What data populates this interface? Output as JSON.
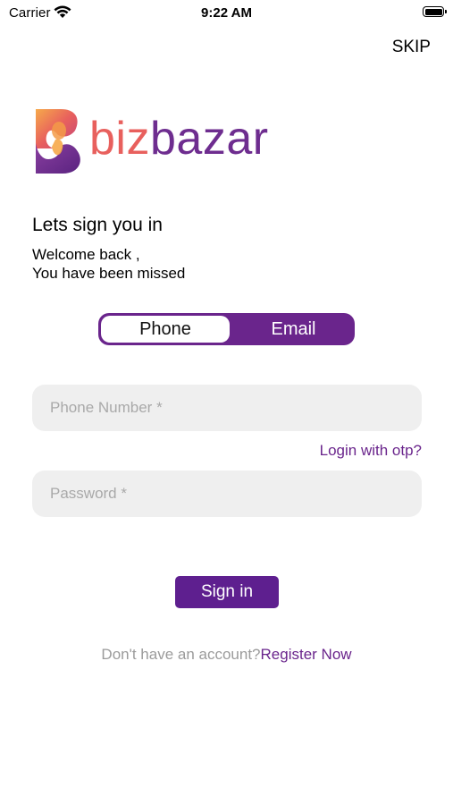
{
  "status_bar": {
    "carrier": "Carrier",
    "time": "9:22 AM",
    "icons": [
      "wifi-icon",
      "battery-icon"
    ]
  },
  "header": {
    "skip_label": "SKIP"
  },
  "logo": {
    "text_part1": "biz",
    "text_part2": "bazar",
    "colors": {
      "biz": "#e8605d",
      "bazar": "#6e2d8f",
      "mark_gradient": [
        "#f6a94a",
        "#e8605d",
        "#6e2d8f"
      ]
    }
  },
  "intro": {
    "heading": "Lets sign you in",
    "line1": "Welcome back ,",
    "line2": "You have been missed"
  },
  "login_mode_toggle": {
    "options": [
      {
        "label": "Phone",
        "selected": true
      },
      {
        "label": "Email",
        "selected": false
      }
    ]
  },
  "form": {
    "phone_placeholder": "Phone Number *",
    "phone_value": "",
    "otp_link": "Login with otp?",
    "password_placeholder": "Password *",
    "password_value": "",
    "submit_label": "Sign in"
  },
  "footer": {
    "prompt": "Don't have an account?",
    "register_link": "Register Now"
  },
  "theme": {
    "accent": "#6a258c",
    "field_bg": "#efefef"
  }
}
